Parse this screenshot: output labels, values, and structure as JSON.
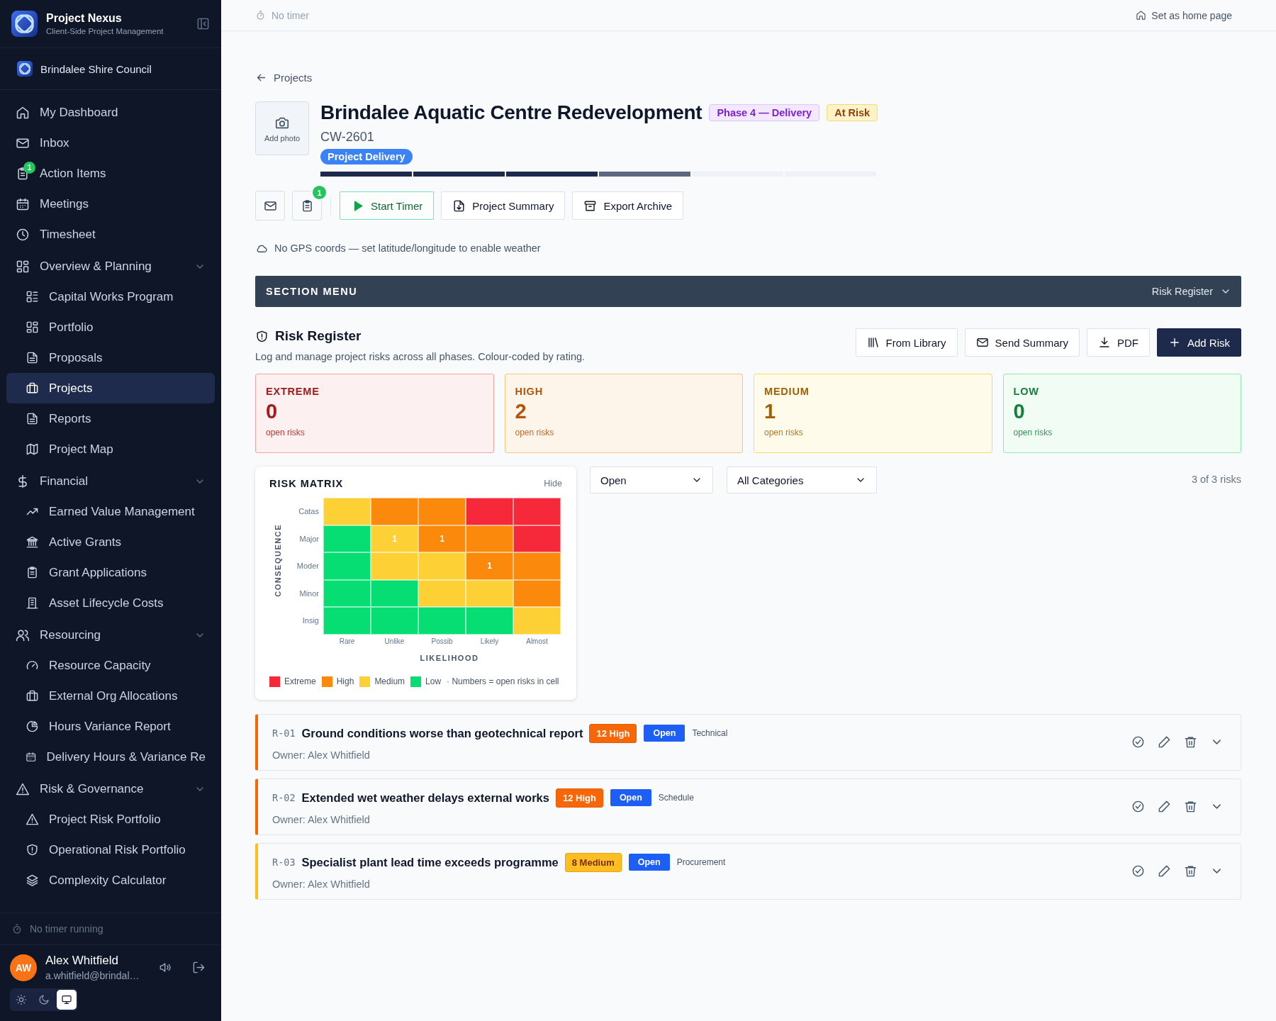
{
  "app": {
    "name": "Project Nexus",
    "subtitle": "Client-Side Project Management"
  },
  "organization": "Brindalee Shire Council",
  "nav": [
    {
      "kind": "item",
      "label": "My Dashboard",
      "selected": false
    },
    {
      "kind": "item",
      "label": "Inbox",
      "selected": false
    },
    {
      "kind": "item",
      "label": "Action Items",
      "selected": false,
      "badge": "1"
    },
    {
      "kind": "item",
      "label": "Meetings",
      "selected": false
    },
    {
      "kind": "item",
      "label": "Timesheet",
      "selected": false
    },
    {
      "kind": "group",
      "label": "Overview & Planning",
      "expanded": true,
      "children": [
        {
          "label": "Capital Works Program",
          "selected": false
        },
        {
          "label": "Portfolio",
          "selected": false
        },
        {
          "label": "Proposals",
          "selected": false
        },
        {
          "label": "Projects",
          "selected": true
        },
        {
          "label": "Reports",
          "selected": false
        },
        {
          "label": "Project Map",
          "selected": false
        }
      ]
    },
    {
      "kind": "group",
      "label": "Financial",
      "expanded": true,
      "children": [
        {
          "label": "Earned Value Management",
          "selected": false
        },
        {
          "label": "Active Grants",
          "selected": false
        },
        {
          "label": "Grant Applications",
          "selected": false
        },
        {
          "label": "Asset Lifecycle Costs",
          "selected": false
        }
      ]
    },
    {
      "kind": "group",
      "label": "Resourcing",
      "expanded": true,
      "children": [
        {
          "label": "Resource Capacity",
          "selected": false
        },
        {
          "label": "External Org Allocations",
          "selected": false
        },
        {
          "label": "Hours Variance Report",
          "selected": false
        },
        {
          "label": "Delivery Hours & Variance Re",
          "selected": false
        }
      ]
    },
    {
      "kind": "group",
      "label": "Risk & Governance",
      "expanded": true,
      "children": [
        {
          "label": "Project Risk Portfolio",
          "selected": false
        },
        {
          "label": "Operational Risk Portfolio",
          "selected": false
        },
        {
          "label": "Complexity Calculator",
          "selected": false
        }
      ]
    }
  ],
  "sidebar_footer": {
    "timer": "No timer running",
    "user": {
      "initials": "AW",
      "name": "Alex Whitfield",
      "email": "a.whitfield@brindal…"
    },
    "themes": [
      {
        "kind": "light",
        "selected": false
      },
      {
        "kind": "dark",
        "selected": false
      },
      {
        "kind": "system",
        "selected": true
      }
    ]
  },
  "topbar": {
    "timer": "No timer",
    "home_link": "Set as home page"
  },
  "breadcrumb": "Projects",
  "project": {
    "photo_label": "Add photo",
    "title": "Brindalee Aquatic Centre Redevelopment",
    "tags": [
      {
        "kind": "phase",
        "text": "Phase 4 — Delivery"
      },
      {
        "kind": "status",
        "text": "At Risk"
      }
    ],
    "code": "CW-2601",
    "stage": "Project Delivery",
    "stages": [
      {
        "kind": "done"
      },
      {
        "kind": "done"
      },
      {
        "kind": "done"
      },
      {
        "kind": "current"
      },
      {
        "kind": "todo"
      },
      {
        "kind": "todo"
      }
    ]
  },
  "toolbar": {
    "tasks_badge": "1",
    "buttons": [
      {
        "kind": "timer",
        "label": "Start Timer"
      },
      {
        "kind": "summary",
        "label": "Project Summary"
      },
      {
        "kind": "archive",
        "label": "Export Archive"
      }
    ]
  },
  "weather_note": "No GPS coords — set latitude/longitude to enable weather",
  "section_menu": {
    "title": "SECTION MENU",
    "current": "Risk Register"
  },
  "risk_register": {
    "title": "Risk Register",
    "description": "Log and manage project risks across all phases. Colour-coded by rating.",
    "buttons": [
      {
        "kind": "library",
        "label": "From Library"
      },
      {
        "kind": "email",
        "label": "Send Summary"
      },
      {
        "kind": "pdf",
        "label": "PDF"
      },
      {
        "kind": "add",
        "label": "Add Risk"
      }
    ],
    "summary": [
      {
        "kind": "extreme",
        "label": "EXTREME",
        "count": "0",
        "caption": "open risks"
      },
      {
        "kind": "high",
        "label": "HIGH",
        "count": "2",
        "caption": "open risks"
      },
      {
        "kind": "medium",
        "label": "MEDIUM",
        "count": "1",
        "caption": "open risks"
      },
      {
        "kind": "low",
        "label": "LOW",
        "count": "0",
        "caption": "open risks"
      }
    ],
    "matrix": {
      "title": "RISK MATRIX",
      "hide": "Hide",
      "y_axis": "CONSEQUENCE",
      "x_axis": "LIKELIHOOD",
      "columns": [
        "Rare",
        "Unlike",
        "Possib",
        "Likely",
        "Almost"
      ],
      "levels": [
        {
          "label": "Catas",
          "squares": [
            {
              "kind": "medium"
            },
            {
              "kind": "high"
            },
            {
              "kind": "high"
            },
            {
              "kind": "extreme"
            },
            {
              "kind": "extreme"
            }
          ]
        },
        {
          "label": "Major",
          "squares": [
            {
              "kind": "low"
            },
            {
              "kind": "medium",
              "count": "1"
            },
            {
              "kind": "high",
              "count": "1"
            },
            {
              "kind": "high"
            },
            {
              "kind": "extreme"
            }
          ]
        },
        {
          "label": "Moder",
          "squares": [
            {
              "kind": "low"
            },
            {
              "kind": "medium"
            },
            {
              "kind": "medium"
            },
            {
              "kind": "high",
              "count": "1"
            },
            {
              "kind": "high"
            }
          ]
        },
        {
          "label": "Minor",
          "squares": [
            {
              "kind": "low"
            },
            {
              "kind": "low"
            },
            {
              "kind": "medium"
            },
            {
              "kind": "medium"
            },
            {
              "kind": "high"
            }
          ]
        },
        {
          "label": "Insig",
          "squares": [
            {
              "kind": "low"
            },
            {
              "kind": "low"
            },
            {
              "kind": "low"
            },
            {
              "kind": "low"
            },
            {
              "kind": "medium"
            }
          ]
        }
      ],
      "legend": [
        {
          "kind": "extreme",
          "label": "Extreme"
        },
        {
          "kind": "high",
          "label": "High"
        },
        {
          "kind": "medium",
          "label": "Medium"
        },
        {
          "kind": "low",
          "label": "Low"
        }
      ],
      "note": "· Numbers = open risks in cell"
    },
    "filters": [
      {
        "value": "Open"
      },
      {
        "value": "All Categories"
      }
    ],
    "result_count": "3 of 3 risks",
    "risks": [
      {
        "id": "R-01",
        "title": "Ground conditions worse than geotechnical report",
        "kind": "high",
        "rating": "12 High",
        "status": "Open",
        "category": "Technical",
        "owner": "Owner: Alex Whitfield"
      },
      {
        "id": "R-02",
        "title": "Extended wet weather delays external works",
        "kind": "high",
        "rating": "12 High",
        "status": "Open",
        "category": "Schedule",
        "owner": "Owner: Alex Whitfield"
      },
      {
        "id": "R-03",
        "title": "Specialist plant lead time exceeds programme",
        "kind": "medium",
        "rating": "8 Medium",
        "status": "Open",
        "category": "Procurement",
        "owner": "Owner: Alex Whitfield"
      }
    ]
  }
}
